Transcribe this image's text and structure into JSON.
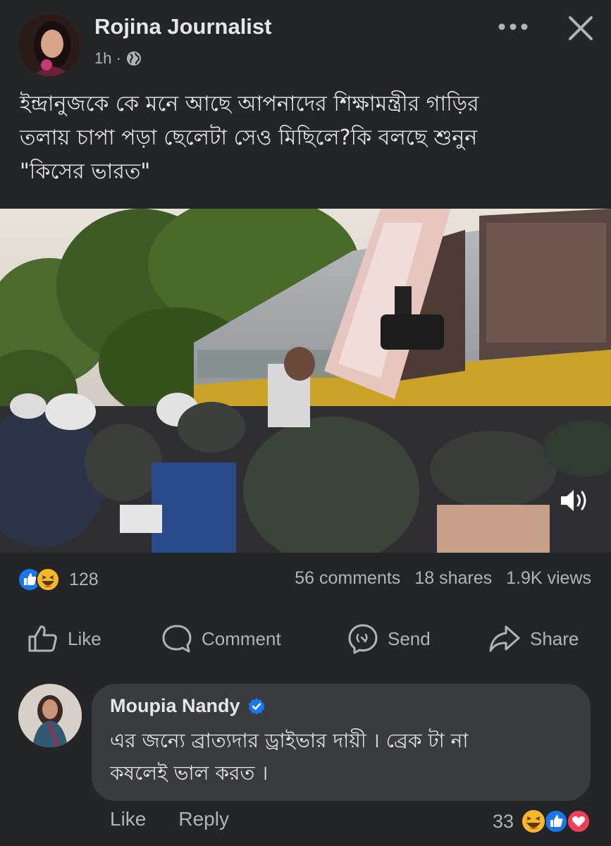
{
  "post": {
    "author": "Rojina Journalist",
    "time": "1h",
    "separator": "·",
    "text": "ইন্দ্রানুজকে কে মনে আছে আপনাদের শিক্ষামন্ত্রীর গাড়ির\nতলায় চাপা পড়া ছেলেটা সেও মিছিলে?কি বলছে শুনুন\n\"কিসের ভারত\"",
    "audience_icon": "globe-icon",
    "more_icon": "more-dots-icon",
    "close_icon": "close-icon"
  },
  "stats": {
    "reaction_count": "128",
    "reaction_types": [
      "like",
      "haha"
    ],
    "comments": "56 comments",
    "shares": "18 shares",
    "views": "1.9K views"
  },
  "actions": {
    "like": "Like",
    "comment": "Comment",
    "send": "Send",
    "share": "Share"
  },
  "comment": {
    "author": "Moupia Nandy",
    "verified": true,
    "text": "এর জন্যে ব্রাত্যদার ড্রাইভার দায়ী । ব্রেক টা না\nকষলেই ভাল করত ।",
    "like_label": "Like",
    "reply_label": "Reply",
    "reaction_count": "33",
    "reaction_types": [
      "haha",
      "like",
      "love"
    ]
  },
  "colors": {
    "background": "#242526",
    "bubble": "#3a3b3c",
    "text_primary": "#e4e6eb",
    "text_secondary": "#b0b3b8",
    "like_blue": "#1877f2",
    "love_red": "#f33e58",
    "haha_yellow": "#f7b928"
  }
}
